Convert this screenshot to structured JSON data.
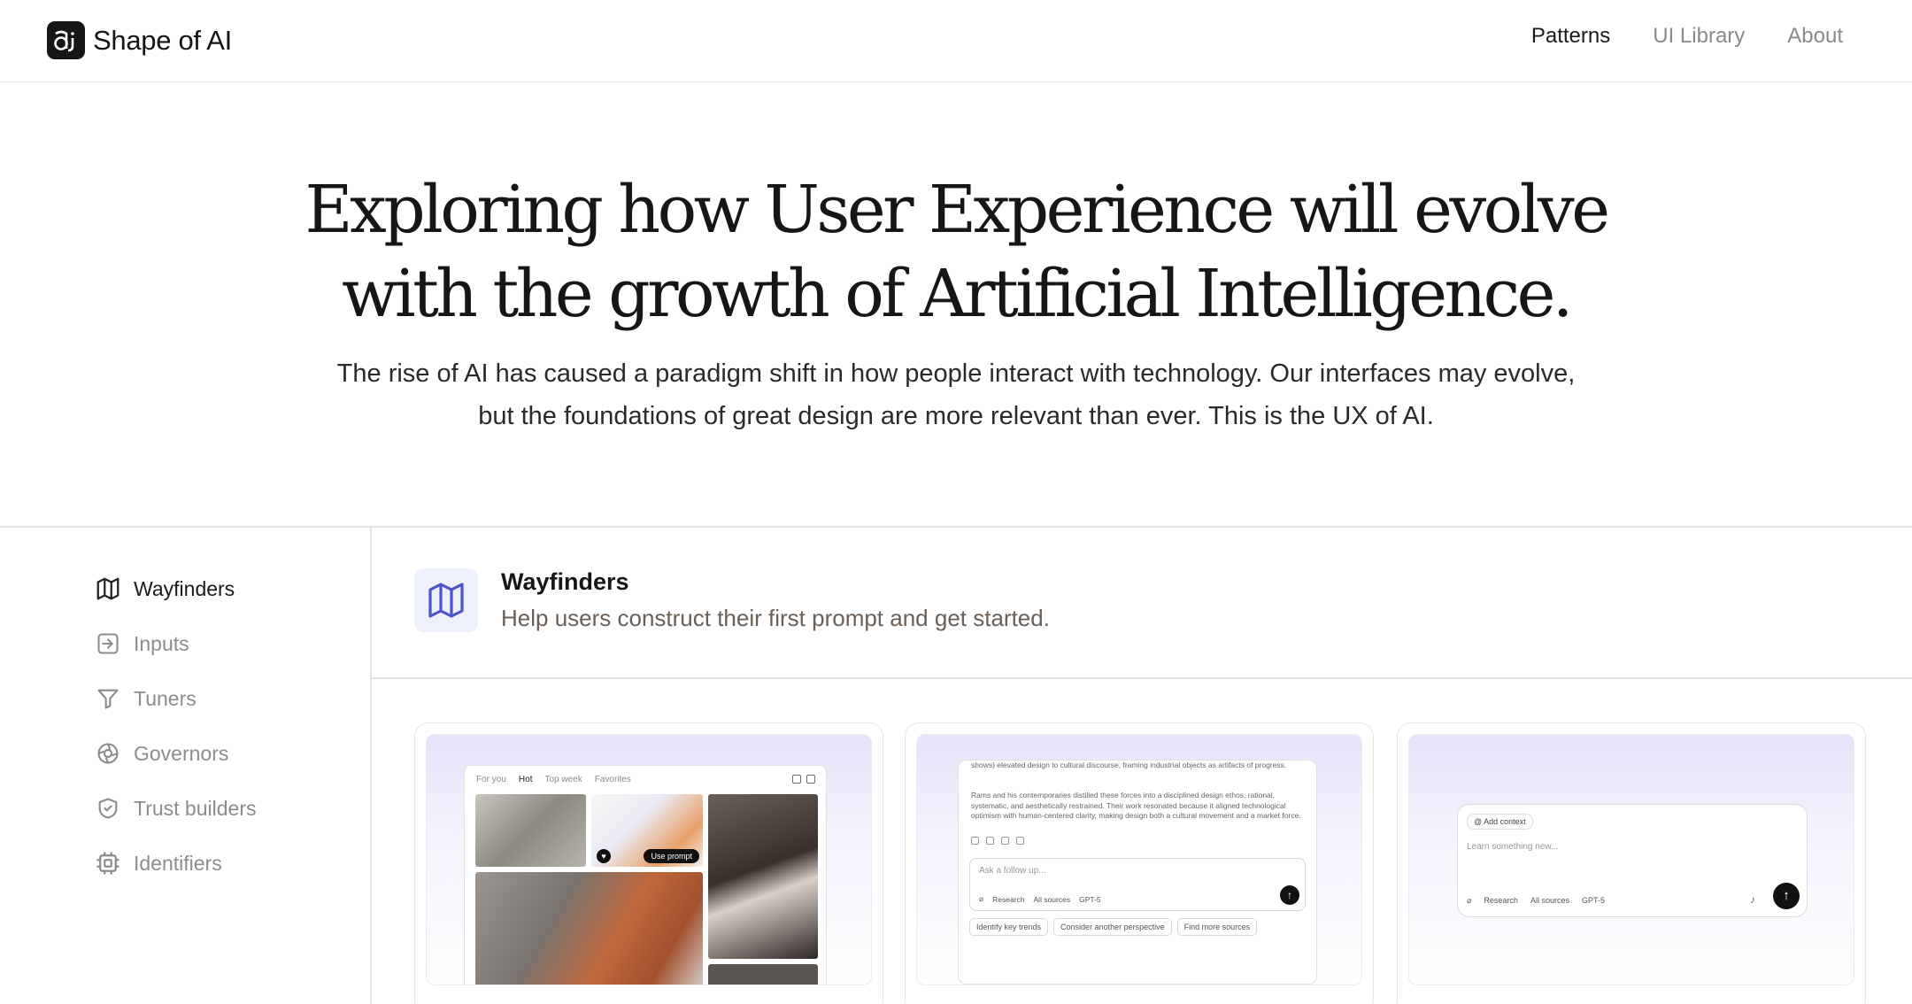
{
  "header": {
    "logo_glyph": "ai",
    "logo_text": "Shape of AI",
    "nav": [
      {
        "label": "Patterns",
        "active": true
      },
      {
        "label": "UI Library",
        "active": false
      },
      {
        "label": "About",
        "active": false
      }
    ]
  },
  "hero": {
    "title_line1": "Exploring how User Experience will evolve",
    "title_line2": "with the growth of Artificial Intelligence.",
    "subtitle": "The rise of AI has caused a paradigm shift in how people interact with technology. Our interfaces may evolve, but the foundations of great design are more relevant than ever. This is the UX of AI."
  },
  "sidebar": {
    "items": [
      {
        "label": "Wayfinders",
        "icon": "map-icon",
        "active": true
      },
      {
        "label": "Inputs",
        "icon": "arrow-in-icon",
        "active": false
      },
      {
        "label": "Tuners",
        "icon": "filter-icon",
        "active": false
      },
      {
        "label": "Governors",
        "icon": "aperture-icon",
        "active": false
      },
      {
        "label": "Trust builders",
        "icon": "shield-icon",
        "active": false
      },
      {
        "label": "Identifiers",
        "icon": "chip-icon",
        "active": false
      }
    ]
  },
  "section": {
    "title": "Wayfinders",
    "description": "Help users construct their first prompt and get started.",
    "accent": "#4b55c9"
  },
  "cards": {
    "card1": {
      "tabs": [
        "For you",
        "Hot",
        "Top week",
        "Favorites"
      ],
      "use_prompt": "Use prompt"
    },
    "card2": {
      "para1": "shows) elevated design to cultural discourse, framing industrial objects as artifacts of progress.",
      "para2": "Rams and his contemporaries distilled these forces into a disciplined design ethos: rational, systematic, and aesthetically restrained. Their work resonated because it aligned technological optimism with human-centered clarity, making design both a cultural movement and a market force.",
      "placeholder": "Ask a follow up...",
      "tool_research": "Research",
      "tool_sources": "All sources",
      "tool_model": "GPT-5",
      "chips": [
        "Identify key trends",
        "Consider another perspective",
        "Find more sources"
      ]
    },
    "card3": {
      "add_context": "@ Add context",
      "placeholder": "Learn something new...",
      "tool_research": "Research",
      "tool_sources": "All sources",
      "tool_model": "GPT-5"
    }
  }
}
